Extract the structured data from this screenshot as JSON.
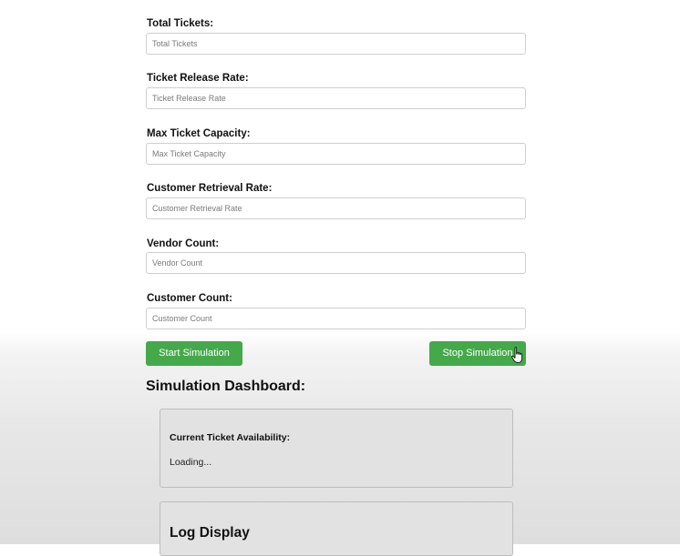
{
  "form": {
    "fields": [
      {
        "label": "Total Tickets:",
        "placeholder": "Total Tickets",
        "value": ""
      },
      {
        "label": "Ticket Release Rate:",
        "placeholder": "Ticket Release Rate",
        "value": ""
      },
      {
        "label": "Max Ticket Capacity:",
        "placeholder": "Max Ticket Capacity",
        "value": ""
      },
      {
        "label": "Customer Retrieval Rate:",
        "placeholder": "Customer Retrieval Rate",
        "value": ""
      },
      {
        "label": "Vendor Count:",
        "placeholder": "Vendor Count",
        "value": ""
      },
      {
        "label": "Customer Count:",
        "placeholder": "Customer Count",
        "value": ""
      }
    ]
  },
  "buttons": {
    "start_label": "Start Simulation",
    "stop_label": "Stop Simulation"
  },
  "dashboard": {
    "title": "Simulation Dashboard:",
    "availability_heading": "Current Ticket Availability:",
    "availability_value": "Loading...",
    "log_heading": "Log Display"
  },
  "colors": {
    "button_green": "#45a84b",
    "panel_background": "#e2e2e2"
  },
  "icons": {
    "cursor": "hand-pointer-cursor-icon"
  }
}
